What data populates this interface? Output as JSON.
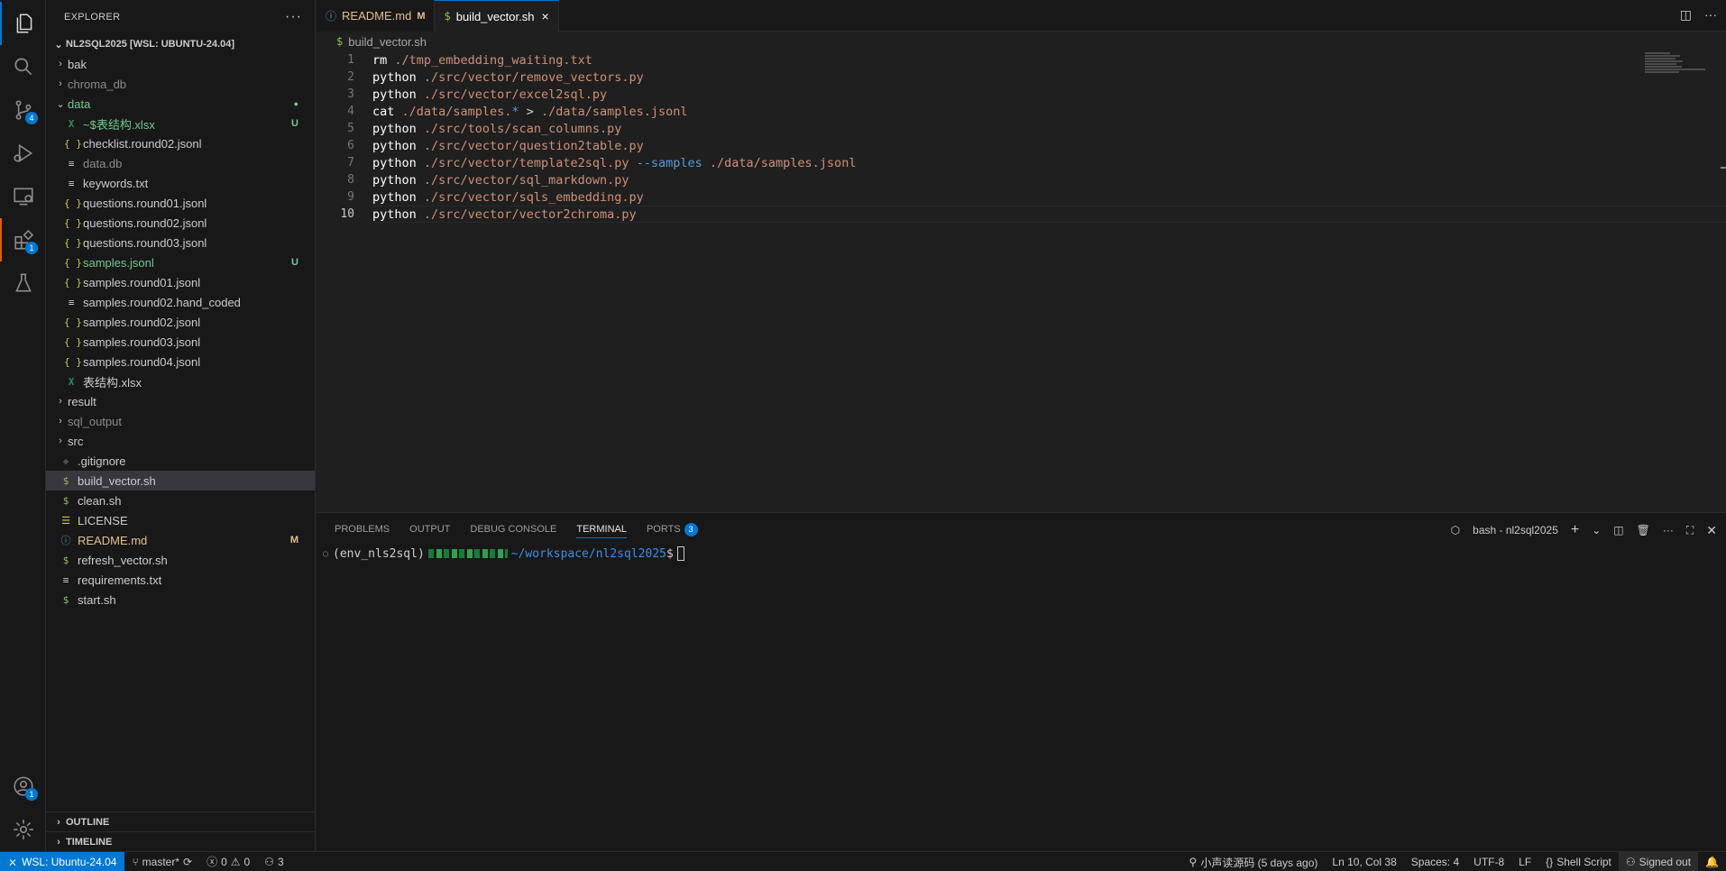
{
  "activity": {
    "scm_badge": "4",
    "ext_badge": "1",
    "account_badge": "1"
  },
  "explorer": {
    "title": "EXPLORER",
    "more": "···",
    "workspace": "NL2SQL2025 [WSL: UBUNTU-24.04]",
    "items": [
      {
        "label": "bak",
        "type": "folder",
        "indent": 0,
        "dim": false
      },
      {
        "label": "chroma_db",
        "type": "folder",
        "indent": 0,
        "dim": true
      },
      {
        "label": "data",
        "type": "folder-open",
        "indent": 0,
        "decor": "●",
        "decor_class": "dot",
        "color": "green"
      },
      {
        "label": "~$表结构.xlsx",
        "type": "xlsx",
        "indent": 1,
        "decor": "U",
        "decor_class": "u",
        "color": "green"
      },
      {
        "label": "checklist.round02.jsonl",
        "type": "json",
        "indent": 1
      },
      {
        "label": "data.db",
        "type": "db",
        "indent": 1,
        "dim": true
      },
      {
        "label": "keywords.txt",
        "type": "txt",
        "indent": 1
      },
      {
        "label": "questions.round01.jsonl",
        "type": "json",
        "indent": 1
      },
      {
        "label": "questions.round02.jsonl",
        "type": "json",
        "indent": 1
      },
      {
        "label": "questions.round03.jsonl",
        "type": "json",
        "indent": 1
      },
      {
        "label": "samples.jsonl",
        "type": "json",
        "indent": 1,
        "decor": "U",
        "decor_class": "u",
        "color": "green"
      },
      {
        "label": "samples.round01.jsonl",
        "type": "json",
        "indent": 1
      },
      {
        "label": "samples.round02.hand_coded",
        "type": "txt",
        "indent": 1
      },
      {
        "label": "samples.round02.jsonl",
        "type": "json",
        "indent": 1
      },
      {
        "label": "samples.round03.jsonl",
        "type": "json",
        "indent": 1
      },
      {
        "label": "samples.round04.jsonl",
        "type": "json",
        "indent": 1
      },
      {
        "label": "表结构.xlsx",
        "type": "xlsx",
        "indent": 1
      },
      {
        "label": "result",
        "type": "folder",
        "indent": 0
      },
      {
        "label": "sql_output",
        "type": "folder",
        "indent": 0,
        "dim": true
      },
      {
        "label": "src",
        "type": "folder",
        "indent": 0
      },
      {
        "label": ".gitignore",
        "type": "git",
        "indent": 0
      },
      {
        "label": "build_vector.sh",
        "type": "sh",
        "indent": 0,
        "selected": true
      },
      {
        "label": "clean.sh",
        "type": "sh",
        "indent": 0
      },
      {
        "label": "LICENSE",
        "type": "lic",
        "indent": 0
      },
      {
        "label": "README.md",
        "type": "info",
        "indent": 0,
        "decor": "M",
        "decor_class": "m",
        "color": "mod"
      },
      {
        "label": "refresh_vector.sh",
        "type": "sh",
        "indent": 0
      },
      {
        "label": "requirements.txt",
        "type": "txt",
        "indent": 0
      },
      {
        "label": "start.sh",
        "type": "sh",
        "indent": 0
      }
    ],
    "outline": "OUTLINE",
    "timeline": "TIMELINE"
  },
  "tabs": [
    {
      "icon": "ⓘ",
      "label": "README.md",
      "suffix": "M",
      "active": false
    },
    {
      "icon": "$",
      "label": "build_vector.sh",
      "suffix": "×",
      "active": true
    }
  ],
  "breadcrumb": "build_vector.sh",
  "code_lines": [
    {
      "n": "1",
      "tokens": [
        {
          "t": "rm ",
          "c": "cmd"
        },
        {
          "t": "./tmp_embedding_waiting.txt",
          "c": "pth"
        }
      ]
    },
    {
      "n": "2",
      "tokens": [
        {
          "t": "python ",
          "c": "cmd"
        },
        {
          "t": "./src/vector/remove_vectors.py",
          "c": "pth"
        }
      ]
    },
    {
      "n": "3",
      "tokens": [
        {
          "t": "python ",
          "c": "cmd"
        },
        {
          "t": "./src/vector/excel2sql.py",
          "c": "pth"
        }
      ]
    },
    {
      "n": "4",
      "tokens": [
        {
          "t": "cat ",
          "c": "cmd"
        },
        {
          "t": "./data/samples.",
          "c": "pth"
        },
        {
          "t": "*",
          "c": "flag"
        },
        {
          "t": " > ",
          "c": "op"
        },
        {
          "t": "./data/samples.jsonl",
          "c": "pth"
        }
      ]
    },
    {
      "n": "5",
      "tokens": [
        {
          "t": "python ",
          "c": "cmd"
        },
        {
          "t": "./src/tools/scan_columns.py",
          "c": "pth"
        }
      ]
    },
    {
      "n": "6",
      "tokens": [
        {
          "t": "python ",
          "c": "cmd"
        },
        {
          "t": "./src/vector/question2table.py",
          "c": "pth"
        }
      ]
    },
    {
      "n": "7",
      "tokens": [
        {
          "t": "python ",
          "c": "cmd"
        },
        {
          "t": "./src/vector/template2sql.py",
          "c": "pth"
        },
        {
          "t": " --samples ",
          "c": "flag"
        },
        {
          "t": "./data/samples.jsonl",
          "c": "pth"
        }
      ]
    },
    {
      "n": "8",
      "tokens": [
        {
          "t": "python ",
          "c": "cmd"
        },
        {
          "t": "./src/vector/sql_markdown.py",
          "c": "pth"
        }
      ]
    },
    {
      "n": "9",
      "tokens": [
        {
          "t": "python ",
          "c": "cmd"
        },
        {
          "t": "./src/vector/sqls_embedding.py",
          "c": "pth"
        }
      ]
    },
    {
      "n": "10",
      "tokens": [
        {
          "t": "python ",
          "c": "cmd"
        },
        {
          "t": "./src/vector/vector2chroma.py",
          "c": "pth"
        }
      ],
      "current": true
    }
  ],
  "panel": {
    "tabs": [
      "PROBLEMS",
      "OUTPUT",
      "DEBUG CONSOLE",
      "TERMINAL",
      "PORTS"
    ],
    "active_tab": "TERMINAL",
    "ports_badge": "3",
    "terminal_name": "bash - nl2sql2025",
    "prompt_env": "(env_nls2sql)",
    "prompt_path": "~/workspace/nl2sql2025",
    "prompt_end": "$"
  },
  "status": {
    "remote": "WSL: Ubuntu-24.04",
    "branch": "master*",
    "errors": "0",
    "warnings": "0",
    "ports": "3",
    "blame": "小声读源码 (5 days ago)",
    "position": "Ln 10, Col 38",
    "spaces": "Spaces: 4",
    "encoding": "UTF-8",
    "eol": "LF",
    "language": "Shell Script",
    "account": "Signed out"
  }
}
